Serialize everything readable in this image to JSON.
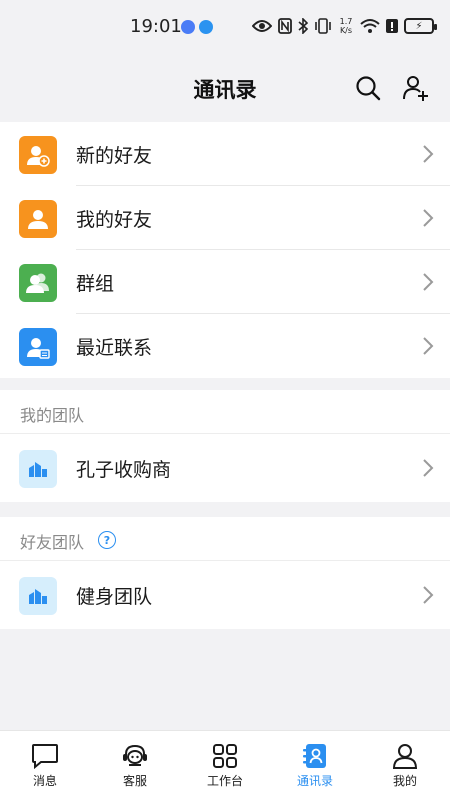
{
  "status_bar": {
    "time": "19:01",
    "net_speed_top": "1.7",
    "net_speed_bottom": "K/s"
  },
  "header": {
    "title": "通讯录"
  },
  "contacts": [
    {
      "label": "新的好友",
      "icon": "new-friend-icon",
      "color": "#f7931e"
    },
    {
      "label": "我的好友",
      "icon": "my-friends-icon",
      "color": "#f7931e"
    },
    {
      "label": "群组",
      "icon": "group-icon",
      "color": "#4caf50"
    },
    {
      "label": "最近联系",
      "icon": "recent-contacts-icon",
      "color": "#2b8ff0"
    }
  ],
  "my_team": {
    "heading": "我的团队",
    "items": [
      {
        "label": "孔子收购商",
        "icon": "team-icon"
      }
    ]
  },
  "friend_team": {
    "heading": "好友团队",
    "help_symbol": "?",
    "items": [
      {
        "label": "健身团队",
        "icon": "team-icon"
      }
    ]
  },
  "tabbar": {
    "tabs": [
      {
        "label": "消息",
        "icon": "message-icon",
        "active": false
      },
      {
        "label": "客服",
        "icon": "headset-icon",
        "active": false
      },
      {
        "label": "工作台",
        "icon": "grid-icon",
        "active": false
      },
      {
        "label": "通讯录",
        "icon": "contacts-icon",
        "active": true
      },
      {
        "label": "我的",
        "icon": "person-icon",
        "active": false
      }
    ]
  },
  "colors": {
    "accent": "#2b8ff0",
    "orange": "#f7931e",
    "green": "#4caf50"
  }
}
